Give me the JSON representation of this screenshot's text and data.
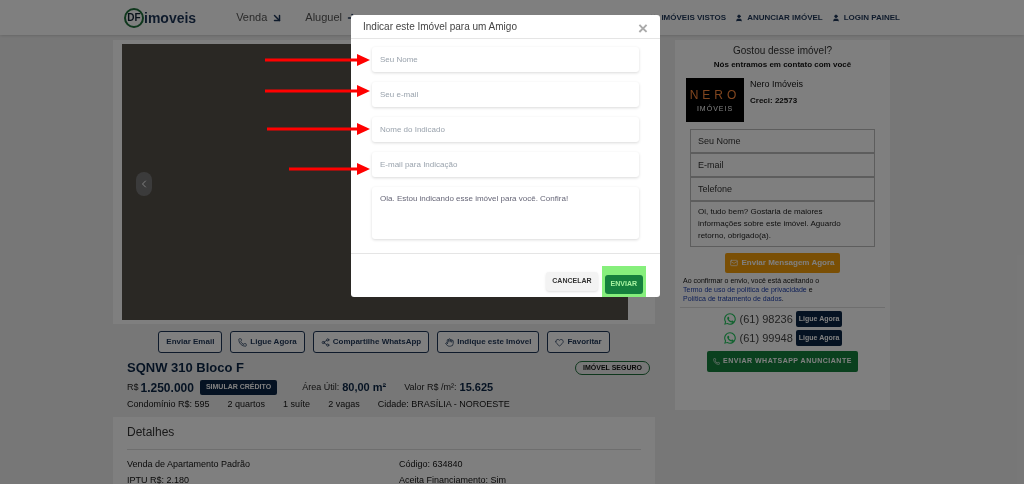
{
  "header": {
    "logo_mark": "DF",
    "logo_text": "imoveis",
    "nav": [
      {
        "label": "Venda"
      },
      {
        "label": "Aluguel"
      }
    ],
    "links": [
      {
        "label": "IMÓVEIS VISTOS"
      },
      {
        "label": "ANUNCIAR IMÓVEL"
      },
      {
        "label": "LOGIN PAINEL"
      }
    ]
  },
  "action_buttons": [
    {
      "label": "Enviar Email"
    },
    {
      "label": "Ligue Agora"
    },
    {
      "label": "Compartilhe WhatsApp"
    },
    {
      "label": "Indique este Imóvel"
    },
    {
      "label": "Favoritar"
    }
  ],
  "listing": {
    "title": "SQNW 310 Bloco F",
    "badge": "IMÓVEL SEGURO",
    "price_prefix": "R$",
    "price": "1.250.000",
    "simulate": "SIMULAR CRÉDITO",
    "area_label": "Área Útil:",
    "area": "80,00 m²",
    "value_label": "Valor R$ /m²:",
    "value": "15.625",
    "facts": [
      "Condomínio R$: 595",
      "2 quartos",
      "1 suíte",
      "2 vagas",
      "Cidade: BRASÍLIA - NOROESTE"
    ]
  },
  "details": {
    "title": "Detalhes",
    "left": [
      "Venda de Apartamento Padrão",
      "IPTU R$: 2.180"
    ],
    "right": [
      "Código: 634840",
      "Aceita Financiamento: Sim"
    ]
  },
  "contact": {
    "title": "Gostou desse imóvel?",
    "subtitle": "Nós entramos em contato com você",
    "agency_logo": [
      "NERO",
      "IMÓVEIS"
    ],
    "agency": "Nero Imóveis",
    "creci": "Creci: 22573",
    "fields": [
      {
        "placeholder": "Seu Nome"
      },
      {
        "placeholder": "E-mail"
      },
      {
        "placeholder": "Telefone"
      }
    ],
    "message": "Oi, tudo bem? Gostaria de maiores informações sobre este imóvel. Aguardo retorno, obrigado(a).",
    "send": "Enviar Mensagem Agora",
    "terms": [
      "Ao confirmar o envio, você está aceitando o ",
      "Termo de uso de política de privacidade",
      " e ",
      "Política de tratamento de dados",
      "."
    ],
    "phones": [
      {
        "number": "(61) 98236",
        "button": "Ligue Agora"
      },
      {
        "number": "(61) 99948",
        "button": "Ligue Agora"
      }
    ],
    "whatsapp": "ENVIAR WHATSAPP ANUNCIANTE"
  },
  "modal": {
    "title": "Indicar este Imóvel para um Amigo",
    "close": "×",
    "fields": [
      {
        "placeholder": "Seu Nome",
        "arrow": true
      },
      {
        "placeholder": "Seu e-mail",
        "arrow": true
      },
      {
        "placeholder": "Nome do Indicado",
        "arrow": true
      },
      {
        "placeholder": "E-mail para Indicação",
        "arrow": true
      }
    ],
    "message": "Ola. Estou indicando esse imóvel para você. Confira!",
    "cancel": "CANCELAR",
    "submit": "ENVIAR",
    "submit_highlighted": true
  }
}
